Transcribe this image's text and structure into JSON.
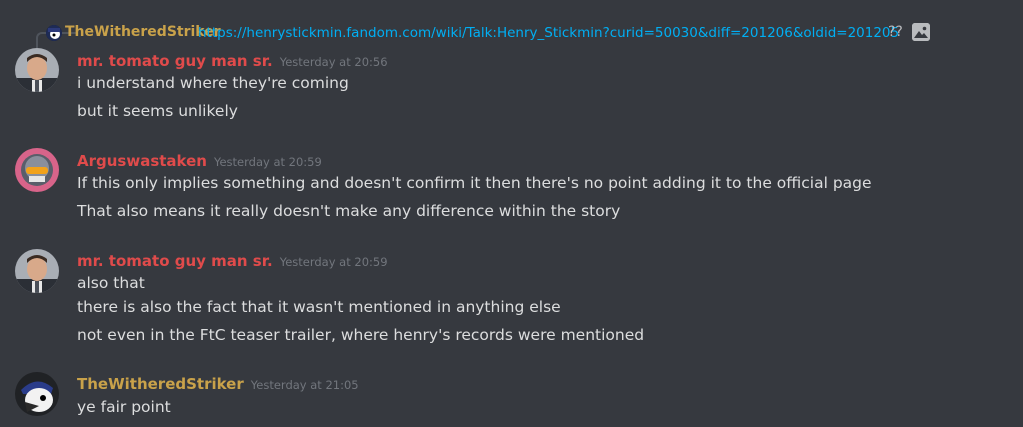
{
  "reply": {
    "author": "TheWitheredStriker",
    "link": "https://henrystickmin.fandom.com/wiki/Talk:Henry_Stickmin?curid=50030&diff=201206&oldid=201205",
    "tail": "??"
  },
  "messages": [
    {
      "username": "mr. tomato guy man sr.",
      "timestamp": "Yesterday at 20:56",
      "color": "#e04b4b",
      "avatar": "office-man-avatar",
      "lines": [
        "i understand where they're coming",
        "but it seems unlikely"
      ]
    },
    {
      "username": "Arguswastaken",
      "timestamp": "Yesterday at 20:59",
      "color": "#e04b4b",
      "avatar": "helmet-avatar",
      "lines": [
        "If this only implies something and doesn't confirm it then there's no point adding it to the official page",
        "That also means it really doesn't make any difference within the story"
      ]
    },
    {
      "username": "mr. tomato guy man sr.",
      "timestamp": "Yesterday at 20:59",
      "color": "#e04b4b",
      "avatar": "office-man-avatar",
      "lines": [
        "also that",
        "there is also the fact that it wasn't mentioned in anything else",
        "not even in the FtC teaser trailer, where henry's records were mentioned"
      ]
    },
    {
      "username": "TheWitheredStriker",
      "timestamp": "Yesterday at 21:05",
      "color": "#c9a24a",
      "avatar": "bird-avatar",
      "lines": [
        "ye fair point"
      ]
    }
  ]
}
